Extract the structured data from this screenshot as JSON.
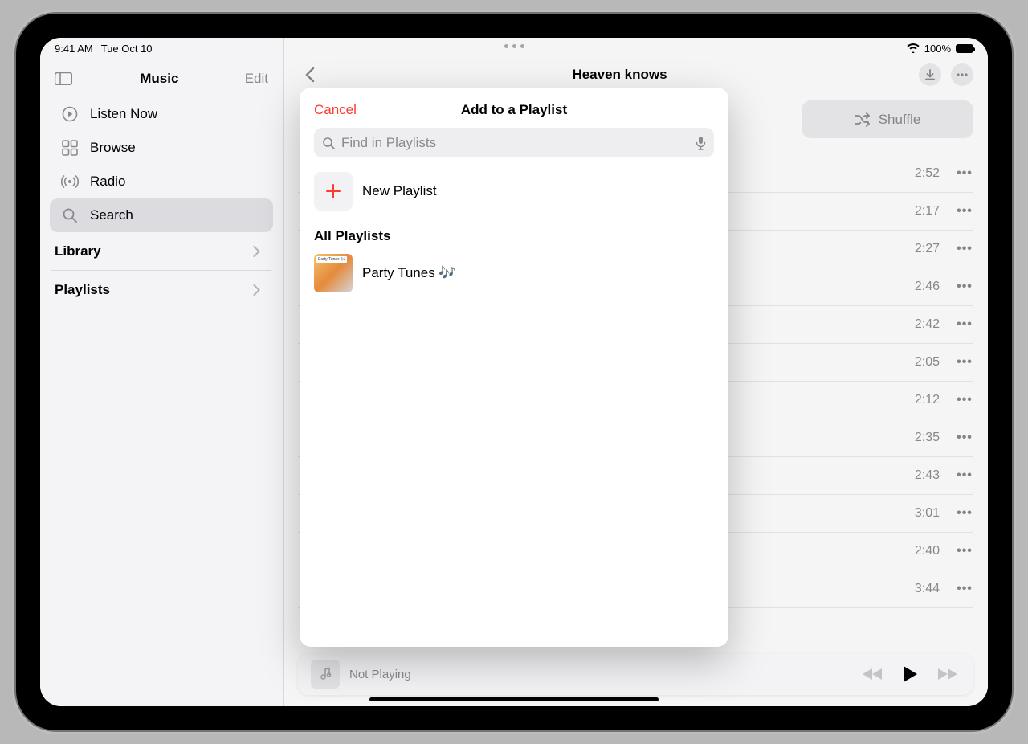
{
  "status": {
    "time": "9:41 AM",
    "date": "Tue Oct 10",
    "battery": "100%"
  },
  "sidebar": {
    "title": "Music",
    "edit": "Edit",
    "items": [
      {
        "label": "Listen Now"
      },
      {
        "label": "Browse"
      },
      {
        "label": "Radio"
      },
      {
        "label": "Search"
      }
    ],
    "sections": [
      {
        "label": "Library"
      },
      {
        "label": "Playlists"
      }
    ]
  },
  "content": {
    "title": "Heaven knows",
    "shuffle": "Shuffle",
    "tracks": [
      {
        "duration": "2:52"
      },
      {
        "duration": "2:17"
      },
      {
        "duration": "2:27"
      },
      {
        "duration": "2:46"
      },
      {
        "duration": "2:42"
      },
      {
        "duration": "2:05"
      },
      {
        "duration": "2:12"
      },
      {
        "duration": "2:35"
      },
      {
        "duration": "2:43"
      },
      {
        "duration": "3:01"
      },
      {
        "duration": "2:40"
      },
      {
        "duration": "3:44"
      }
    ]
  },
  "now_playing": {
    "label": "Not Playing"
  },
  "popover": {
    "cancel": "Cancel",
    "title": "Add to a Playlist",
    "search_placeholder": "Find in Playlists",
    "new_playlist": "New Playlist",
    "section": "All Playlists",
    "playlists": [
      {
        "name": "Party Tunes 🎶",
        "art_label": "Party Tunes 🎶"
      }
    ]
  }
}
